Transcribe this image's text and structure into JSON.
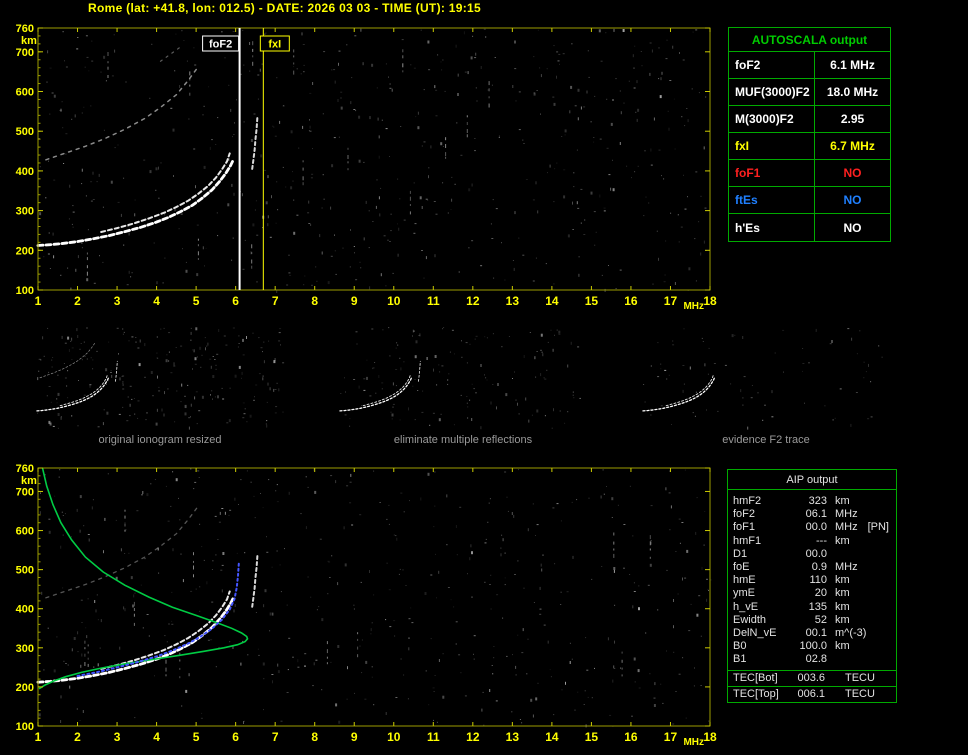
{
  "title": "Rome (lat: +41.8, lon: 012.5) - DATE: 2026 03 03 - TIME (UT): 19:15",
  "colors": {
    "axis_yellow": "#ffff00",
    "plot_border": "#9c9c00",
    "table_green": "#00aa00",
    "trace_white": "#ffffff",
    "profile_green": "#00cc44",
    "fit_blue": "#4455ff"
  },
  "autoscala_table": {
    "title": "AUTOSCALA output",
    "rows": [
      {
        "label": "foF2",
        "value": "6.1 MHz",
        "label_color": "#ffffff",
        "value_color": "#ffffff"
      },
      {
        "label": "MUF(3000)F2",
        "value": "18.0 MHz",
        "label_color": "#ffffff",
        "value_color": "#ffffff"
      },
      {
        "label": "M(3000)F2",
        "value": "2.95",
        "label_color": "#ffffff",
        "value_color": "#ffffff"
      },
      {
        "label": "fxI",
        "value": "6.7 MHz",
        "label_color": "#ffff00",
        "value_color": "#ffff00"
      },
      {
        "label": "foF1",
        "value": "NO",
        "label_color": "#ff2020",
        "value_color": "#ff2020"
      },
      {
        "label": "ftEs",
        "value": "NO",
        "label_color": "#2080ff",
        "value_color": "#2080ff"
      },
      {
        "label": "h'Es",
        "value": "NO",
        "label_color": "#ffffff",
        "value_color": "#ffffff"
      }
    ]
  },
  "thumbnails": [
    {
      "caption": "original ionogram resized"
    },
    {
      "caption": "eliminate multiple reflections"
    },
    {
      "caption": "evidence F2 trace"
    }
  ],
  "aip_table": {
    "title": "AIP output",
    "rows": [
      {
        "label": "hmF2",
        "value": "323",
        "unit": "km",
        "note": ""
      },
      {
        "label": "foF2",
        "value": "06.1",
        "unit": "MHz",
        "note": ""
      },
      {
        "label": "foF1",
        "value": "00.0",
        "unit": "MHz",
        "note": "[PN]"
      },
      {
        "label": "hmF1",
        "value": "---",
        "unit": "km",
        "note": ""
      },
      {
        "label": "D1",
        "value": "00.0",
        "unit": "",
        "note": ""
      },
      {
        "label": "foE",
        "value": "0.9",
        "unit": "MHz",
        "note": ""
      },
      {
        "label": "hmE",
        "value": "110",
        "unit": "km",
        "note": ""
      },
      {
        "label": "ymE",
        "value": "20",
        "unit": "km",
        "note": ""
      },
      {
        "label": "h_vE",
        "value": "135",
        "unit": "km",
        "note": ""
      },
      {
        "label": "Ewidth",
        "value": "52",
        "unit": "km",
        "note": ""
      },
      {
        "label": "DelN_vE",
        "value": "00.1",
        "unit": "m^(-3)",
        "note": ""
      },
      {
        "label": "B0",
        "value": "100.0",
        "unit": "km",
        "note": ""
      },
      {
        "label": "B1",
        "value": "02.8",
        "unit": "",
        "note": ""
      }
    ],
    "tec_rows": [
      {
        "label": "TEC[Bot]",
        "value": "003.6",
        "unit": "TECU"
      },
      {
        "label": "TEC[Top]",
        "value": "006.1",
        "unit": "TECU"
      }
    ]
  },
  "chart_data": [
    {
      "type": "scatter",
      "name": "top-ionogram",
      "title": "scaled ionogram with foF2 / fxI markers",
      "xlabel": "MHz",
      "ylabel": "km",
      "xlim": [
        1,
        18
      ],
      "ylim": [
        100,
        760
      ],
      "x_ticks": [
        1,
        2,
        3,
        4,
        5,
        6,
        7,
        8,
        9,
        10,
        11,
        12,
        13,
        14,
        15,
        16,
        17,
        18
      ],
      "y_ticks": [
        760,
        700,
        600,
        500,
        400,
        300,
        200,
        100
      ],
      "markers": [
        {
          "label": "foF2",
          "x": 6.1,
          "color": "#ffffff"
        },
        {
          "label": "fxI",
          "x": 6.7,
          "color": "#ffff00"
        }
      ],
      "series": [
        {
          "name": "f2-trace-o-mode",
          "color": "#ffffff",
          "width": 2.8,
          "dash": "5 3",
          "points": [
            [
              1.0,
              212
            ],
            [
              1.3,
              214
            ],
            [
              1.6,
              217
            ],
            [
              2.0,
              222
            ],
            [
              2.4,
              229
            ],
            [
              2.8,
              237
            ],
            [
              3.2,
              247
            ],
            [
              3.6,
              258
            ],
            [
              4.0,
              271
            ],
            [
              4.3,
              283
            ],
            [
              4.6,
              297
            ],
            [
              4.9,
              313
            ],
            [
              5.15,
              331
            ],
            [
              5.4,
              352
            ],
            [
              5.6,
              374
            ],
            [
              5.75,
              394
            ],
            [
              5.87,
              413
            ],
            [
              5.95,
              430
            ]
          ]
        },
        {
          "name": "f2-trace-x-mode",
          "color": "#e8e8e8",
          "width": 2,
          "dash": "4 3",
          "points": [
            [
              2.6,
              246
            ],
            [
              3.0,
              256
            ],
            [
              3.4,
              267
            ],
            [
              3.8,
              280
            ],
            [
              4.2,
              295
            ],
            [
              4.5,
              309
            ],
            [
              4.8,
              325
            ],
            [
              5.05,
              342
            ],
            [
              5.3,
              362
            ],
            [
              5.5,
              383
            ],
            [
              5.65,
              403
            ],
            [
              5.78,
              424
            ],
            [
              5.85,
              444
            ]
          ]
        },
        {
          "name": "x-mode-cusp",
          "color": "#d8d8d8",
          "width": 2,
          "dash": "3 3",
          "points": [
            [
              6.42,
              405
            ],
            [
              6.45,
              428
            ],
            [
              6.48,
              452
            ],
            [
              6.5,
              478
            ],
            [
              6.53,
              506
            ],
            [
              6.55,
              536
            ]
          ]
        },
        {
          "name": "second-hop-trace",
          "color": "#b8b8b8",
          "width": 1.5,
          "dash": "3 5",
          "opacity": 0.75,
          "points": [
            [
              1.2,
              428
            ],
            [
              1.7,
              445
            ],
            [
              2.2,
              462
            ],
            [
              2.7,
              482
            ],
            [
              3.2,
              505
            ],
            [
              3.7,
              532
            ],
            [
              4.1,
              560
            ],
            [
              4.5,
              592
            ],
            [
              4.8,
              628
            ],
            [
              5.05,
              662
            ]
          ]
        },
        {
          "name": "second-hop-upper",
          "color": "#999999",
          "width": 1.2,
          "dash": "2 5",
          "opacity": 0.6,
          "points": [
            [
              4.1,
              676
            ],
            [
              4.35,
              694
            ],
            [
              4.6,
              712
            ]
          ]
        }
      ]
    },
    {
      "type": "scatter",
      "name": "bottom-ionogram",
      "title": "ionogram with restored trace and electron density profile",
      "xlabel": "MHz",
      "ylabel": "km",
      "xlim": [
        1,
        18
      ],
      "ylim": [
        100,
        760
      ],
      "x_ticks": [
        1,
        2,
        3,
        4,
        5,
        6,
        7,
        8,
        9,
        10,
        11,
        12,
        13,
        14,
        15,
        16,
        17,
        18
      ],
      "y_ticks": [
        760,
        700,
        600,
        500,
        400,
        300,
        200,
        100
      ],
      "series": [
        {
          "name": "f2-trace-o-mode",
          "color": "#ffffff",
          "width": 2.8,
          "dash": "5 3",
          "points": [
            [
              1.0,
              212
            ],
            [
              1.3,
              214
            ],
            [
              1.6,
              217
            ],
            [
              2.0,
              222
            ],
            [
              2.4,
              229
            ],
            [
              2.8,
              237
            ],
            [
              3.2,
              247
            ],
            [
              3.6,
              258
            ],
            [
              4.0,
              271
            ],
            [
              4.3,
              283
            ],
            [
              4.6,
              297
            ],
            [
              4.9,
              313
            ],
            [
              5.15,
              331
            ],
            [
              5.4,
              352
            ],
            [
              5.6,
              374
            ],
            [
              5.75,
              394
            ],
            [
              5.87,
              413
            ],
            [
              5.95,
              430
            ]
          ]
        },
        {
          "name": "f2-trace-x-mode",
          "color": "#e8e8e8",
          "width": 2,
          "dash": "4 3",
          "points": [
            [
              2.6,
              246
            ],
            [
              3.0,
              256
            ],
            [
              3.4,
              267
            ],
            [
              3.8,
              280
            ],
            [
              4.2,
              295
            ],
            [
              4.5,
              309
            ],
            [
              4.8,
              325
            ],
            [
              5.05,
              342
            ],
            [
              5.3,
              362
            ],
            [
              5.5,
              383
            ],
            [
              5.65,
              403
            ],
            [
              5.78,
              424
            ],
            [
              5.85,
              444
            ]
          ]
        },
        {
          "name": "x-mode-cusp",
          "color": "#d8d8d8",
          "width": 2,
          "dash": "3 3",
          "points": [
            [
              6.42,
              405
            ],
            [
              6.45,
              428
            ],
            [
              6.48,
              452
            ],
            [
              6.5,
              478
            ],
            [
              6.53,
              506
            ],
            [
              6.55,
              536
            ]
          ]
        },
        {
          "name": "second-hop-trace",
          "color": "#9a9a9a",
          "width": 1.3,
          "dash": "3 5",
          "opacity": 0.55,
          "points": [
            [
              1.2,
              428
            ],
            [
              1.7,
              445
            ],
            [
              2.2,
              462
            ],
            [
              2.7,
              482
            ],
            [
              3.2,
              505
            ],
            [
              3.7,
              532
            ],
            [
              4.1,
              560
            ],
            [
              4.5,
              592
            ],
            [
              4.8,
              628
            ],
            [
              5.05,
              662
            ]
          ]
        },
        {
          "name": "electron-density-profile",
          "color": "#00cc44",
          "width": 1.6,
          "dash": "",
          "points": [
            [
              1.12,
              758
            ],
            [
              1.22,
              714
            ],
            [
              1.38,
              666
            ],
            [
              1.58,
              620
            ],
            [
              1.85,
              576
            ],
            [
              2.2,
              532
            ],
            [
              2.65,
              494
            ],
            [
              3.2,
              460
            ],
            [
              3.8,
              430
            ],
            [
              4.4,
              404
            ],
            [
              5.0,
              383
            ],
            [
              5.5,
              365
            ],
            [
              5.9,
              350
            ],
            [
              6.15,
              338
            ],
            [
              6.28,
              329
            ],
            [
              6.3,
              323
            ],
            [
              6.24,
              316
            ],
            [
              6.05,
              308
            ],
            [
              5.7,
              300
            ],
            [
              5.2,
              291
            ],
            [
              4.6,
              281
            ],
            [
              3.9,
              270
            ],
            [
              3.2,
              259
            ],
            [
              2.6,
              248
            ],
            [
              2.1,
              237
            ],
            [
              1.7,
              226
            ],
            [
              1.4,
              215
            ],
            [
              1.18,
              205
            ],
            [
              1.04,
              196
            ]
          ]
        },
        {
          "name": "restored-trace-fit",
          "color": "#4455ff",
          "width": 2,
          "dash": "2 3",
          "points": [
            [
              2.0,
              228
            ],
            [
              2.5,
              238
            ],
            [
              3.0,
              250
            ],
            [
              3.5,
              263
            ],
            [
              4.0,
              278
            ],
            [
              4.4,
              293
            ],
            [
              4.8,
              311
            ],
            [
              5.1,
              328
            ],
            [
              5.4,
              349
            ],
            [
              5.65,
              372
            ],
            [
              5.85,
              398
            ],
            [
              5.97,
              425
            ],
            [
              6.03,
              455
            ],
            [
              6.06,
              485
            ],
            [
              6.08,
              515
            ]
          ]
        }
      ]
    }
  ]
}
